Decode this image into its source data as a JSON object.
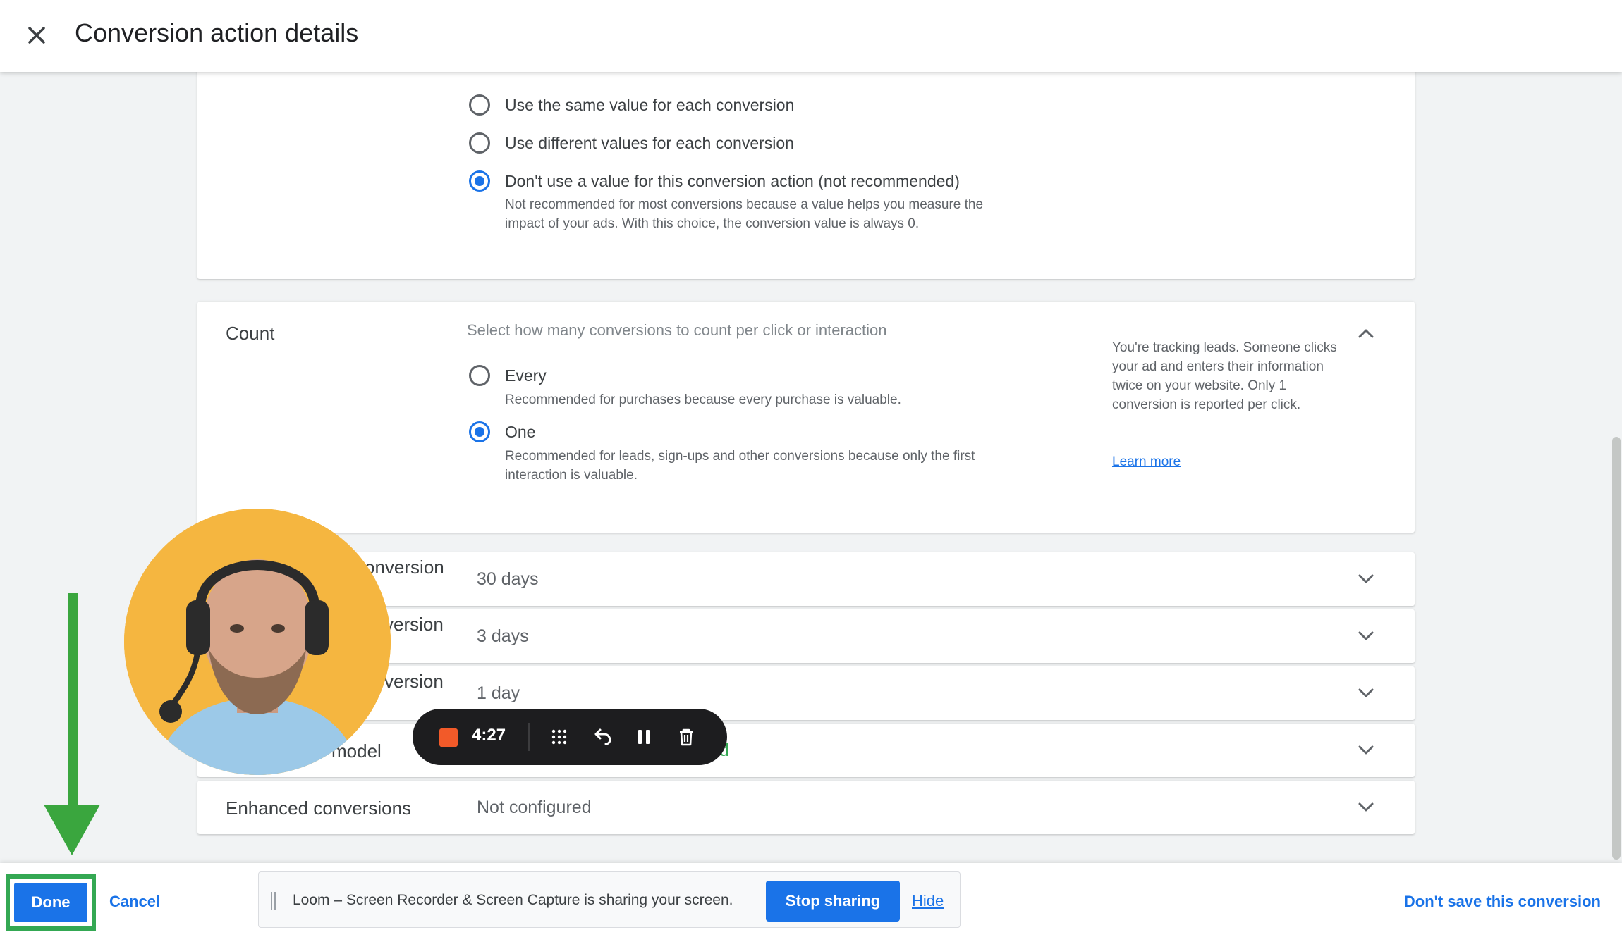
{
  "header": {
    "title": "Conversion action details"
  },
  "value_section": {
    "options": [
      {
        "label": "Use the same value for each conversion",
        "checked": false
      },
      {
        "label": "Use different values for each conversion",
        "checked": false
      },
      {
        "label": "Don't use a value for this conversion action (not recommended)",
        "checked": true
      }
    ],
    "desc_line1": "Not recommended for most conversions because a value helps you measure the",
    "desc_line2": "impact of your ads. With this choice, the conversion value is always 0."
  },
  "count_section": {
    "title": "Count",
    "hint": "Select how many conversions to count per click or interaction",
    "every_label": "Every",
    "every_desc": "Recommended for purchases because every purchase is valuable.",
    "one_label": "One",
    "one_desc_line1": "Recommended for leads, sign-ups and other conversions because only the first",
    "one_desc_line2": "interaction is valuable.",
    "side_text": "You're tracking leads. Someone clicks your ad and enters their information twice on your website. Only 1 conversion is reported per click.",
    "learn_more": "Learn more"
  },
  "rows": [
    {
      "label": "onversion",
      "value": "30 days"
    },
    {
      "label": "version",
      "value": "3 days"
    },
    {
      "label": "version",
      "value": "1 day"
    },
    {
      "label": "model",
      "value": "d"
    },
    {
      "label": "Enhanced conversions",
      "value": "Not configured"
    }
  ],
  "recorder": {
    "time": "4:27"
  },
  "bottom": {
    "done": "Done",
    "cancel": "Cancel",
    "loom_text": "Loom – Screen Recorder & Screen Capture is sharing your screen.",
    "stop_sharing": "Stop sharing",
    "hide": "Hide",
    "dont_save": "Don't save this conversion"
  },
  "colors": {
    "accent": "#1a73e8",
    "arrow": "#34a853",
    "record": "#f25a29"
  }
}
